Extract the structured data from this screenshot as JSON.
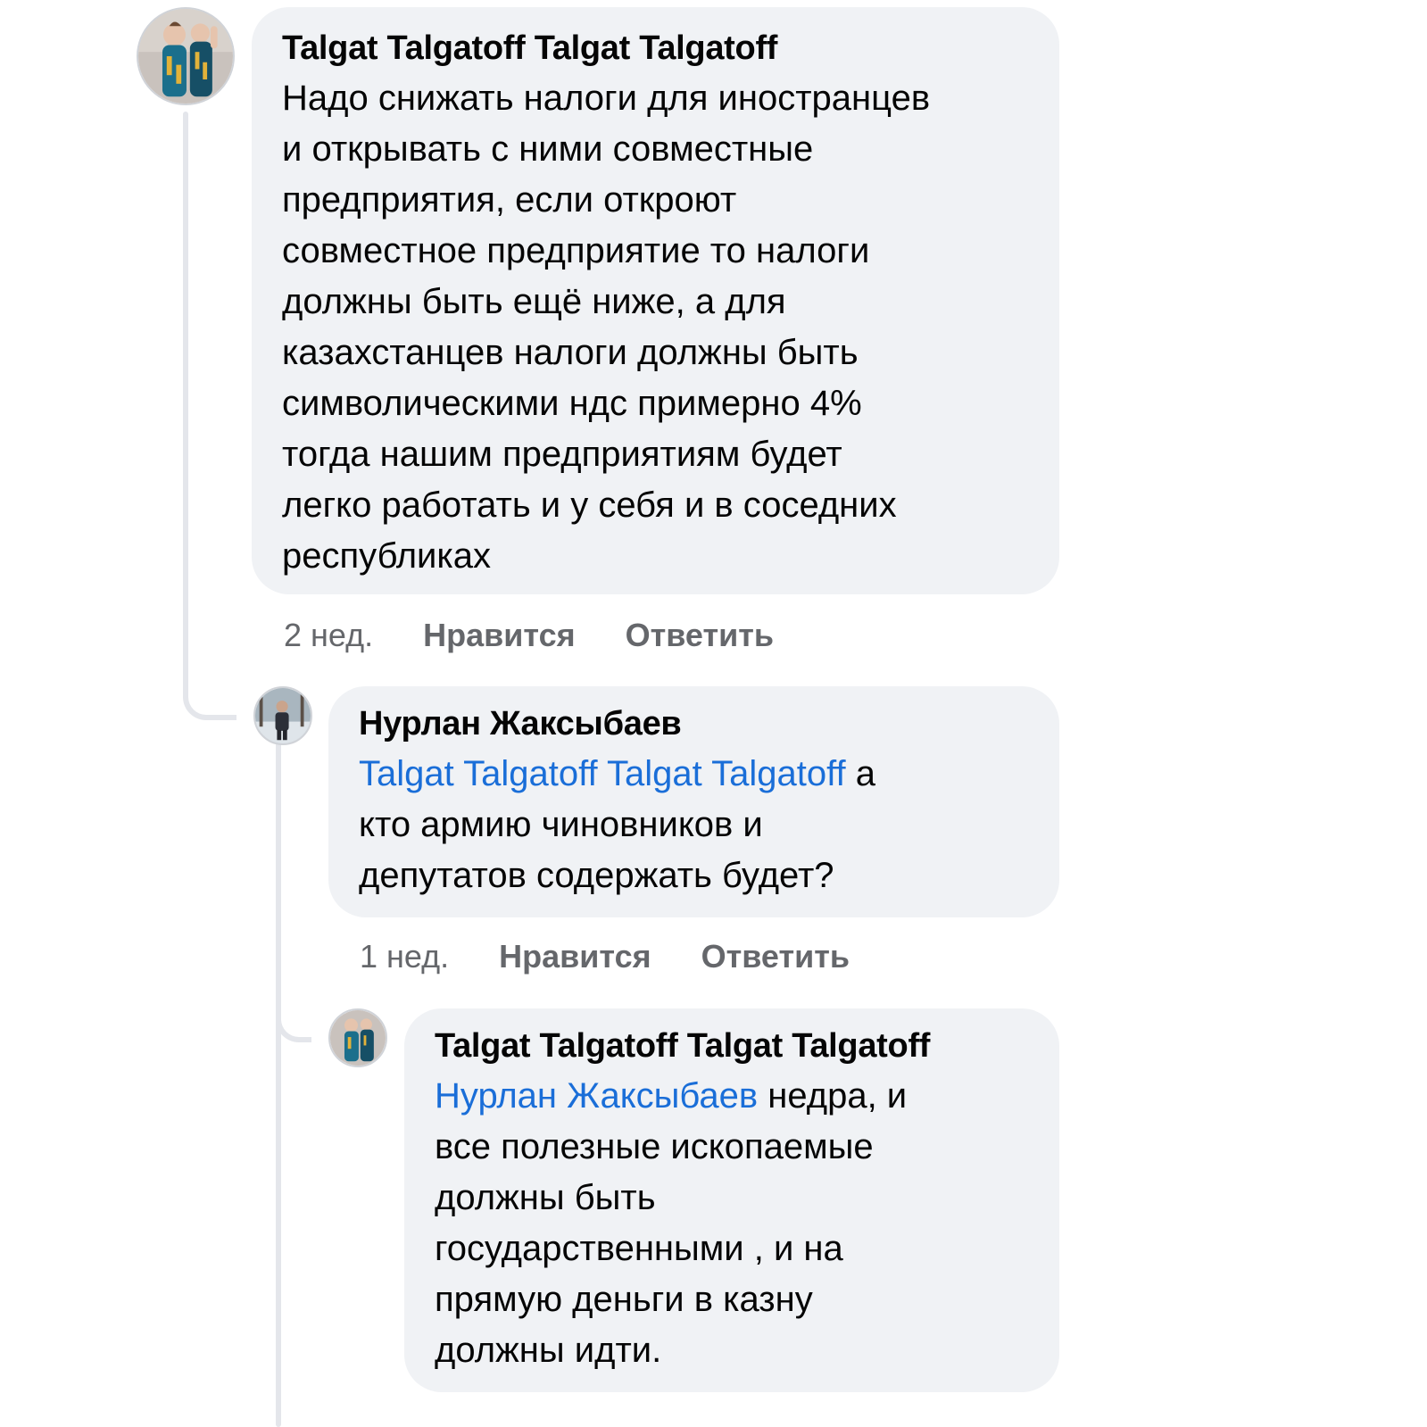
{
  "comments": [
    {
      "author": "Talgat Talgatoff Talgat Talgatoff",
      "avatar": "child-photo-avatar",
      "lines": [
        "Надо снижать налоги для иностранцев",
        "и открывать с ними совместные",
        "предприятия, если откроют",
        "совместное предприятие то налоги",
        "должны быть ещё ниже, а для",
        "казахстанцев налоги должны быть",
        "символическими ндс примерно 4%",
        "тогда нашим предприятиям будет",
        "легко работать и у себя и в соседних",
        "республиках"
      ],
      "time": "2 нед.",
      "like": "Нравится",
      "reply": "Ответить"
    },
    {
      "author": "Нурлан Жаксыбаев",
      "avatar": "winter-photo-avatar",
      "mention": "Talgat Talgatoff Talgat Talgatoff",
      "first_line_rest": " а",
      "lines": [
        "кто армию чиновников и",
        "депутатов содержать будет?"
      ],
      "time": "1 нед.",
      "like": "Нравится",
      "reply": "Ответить"
    },
    {
      "author": "Talgat Talgatoff Talgat Talgatoff",
      "avatar": "child-photo-avatar",
      "mention": "Нурлан Жаксыбаев",
      "first_line_rest": " недра, и",
      "lines": [
        "все полезные ископаемые",
        "должны быть",
        "государственными , и на",
        "прямую деньги в казну",
        "должны идти."
      ]
    }
  ],
  "colors": {
    "bubble": "#f0f2f5",
    "mention": "#1a6ed8",
    "meta": "#65676b",
    "thread_line": "#e4e6eb"
  }
}
